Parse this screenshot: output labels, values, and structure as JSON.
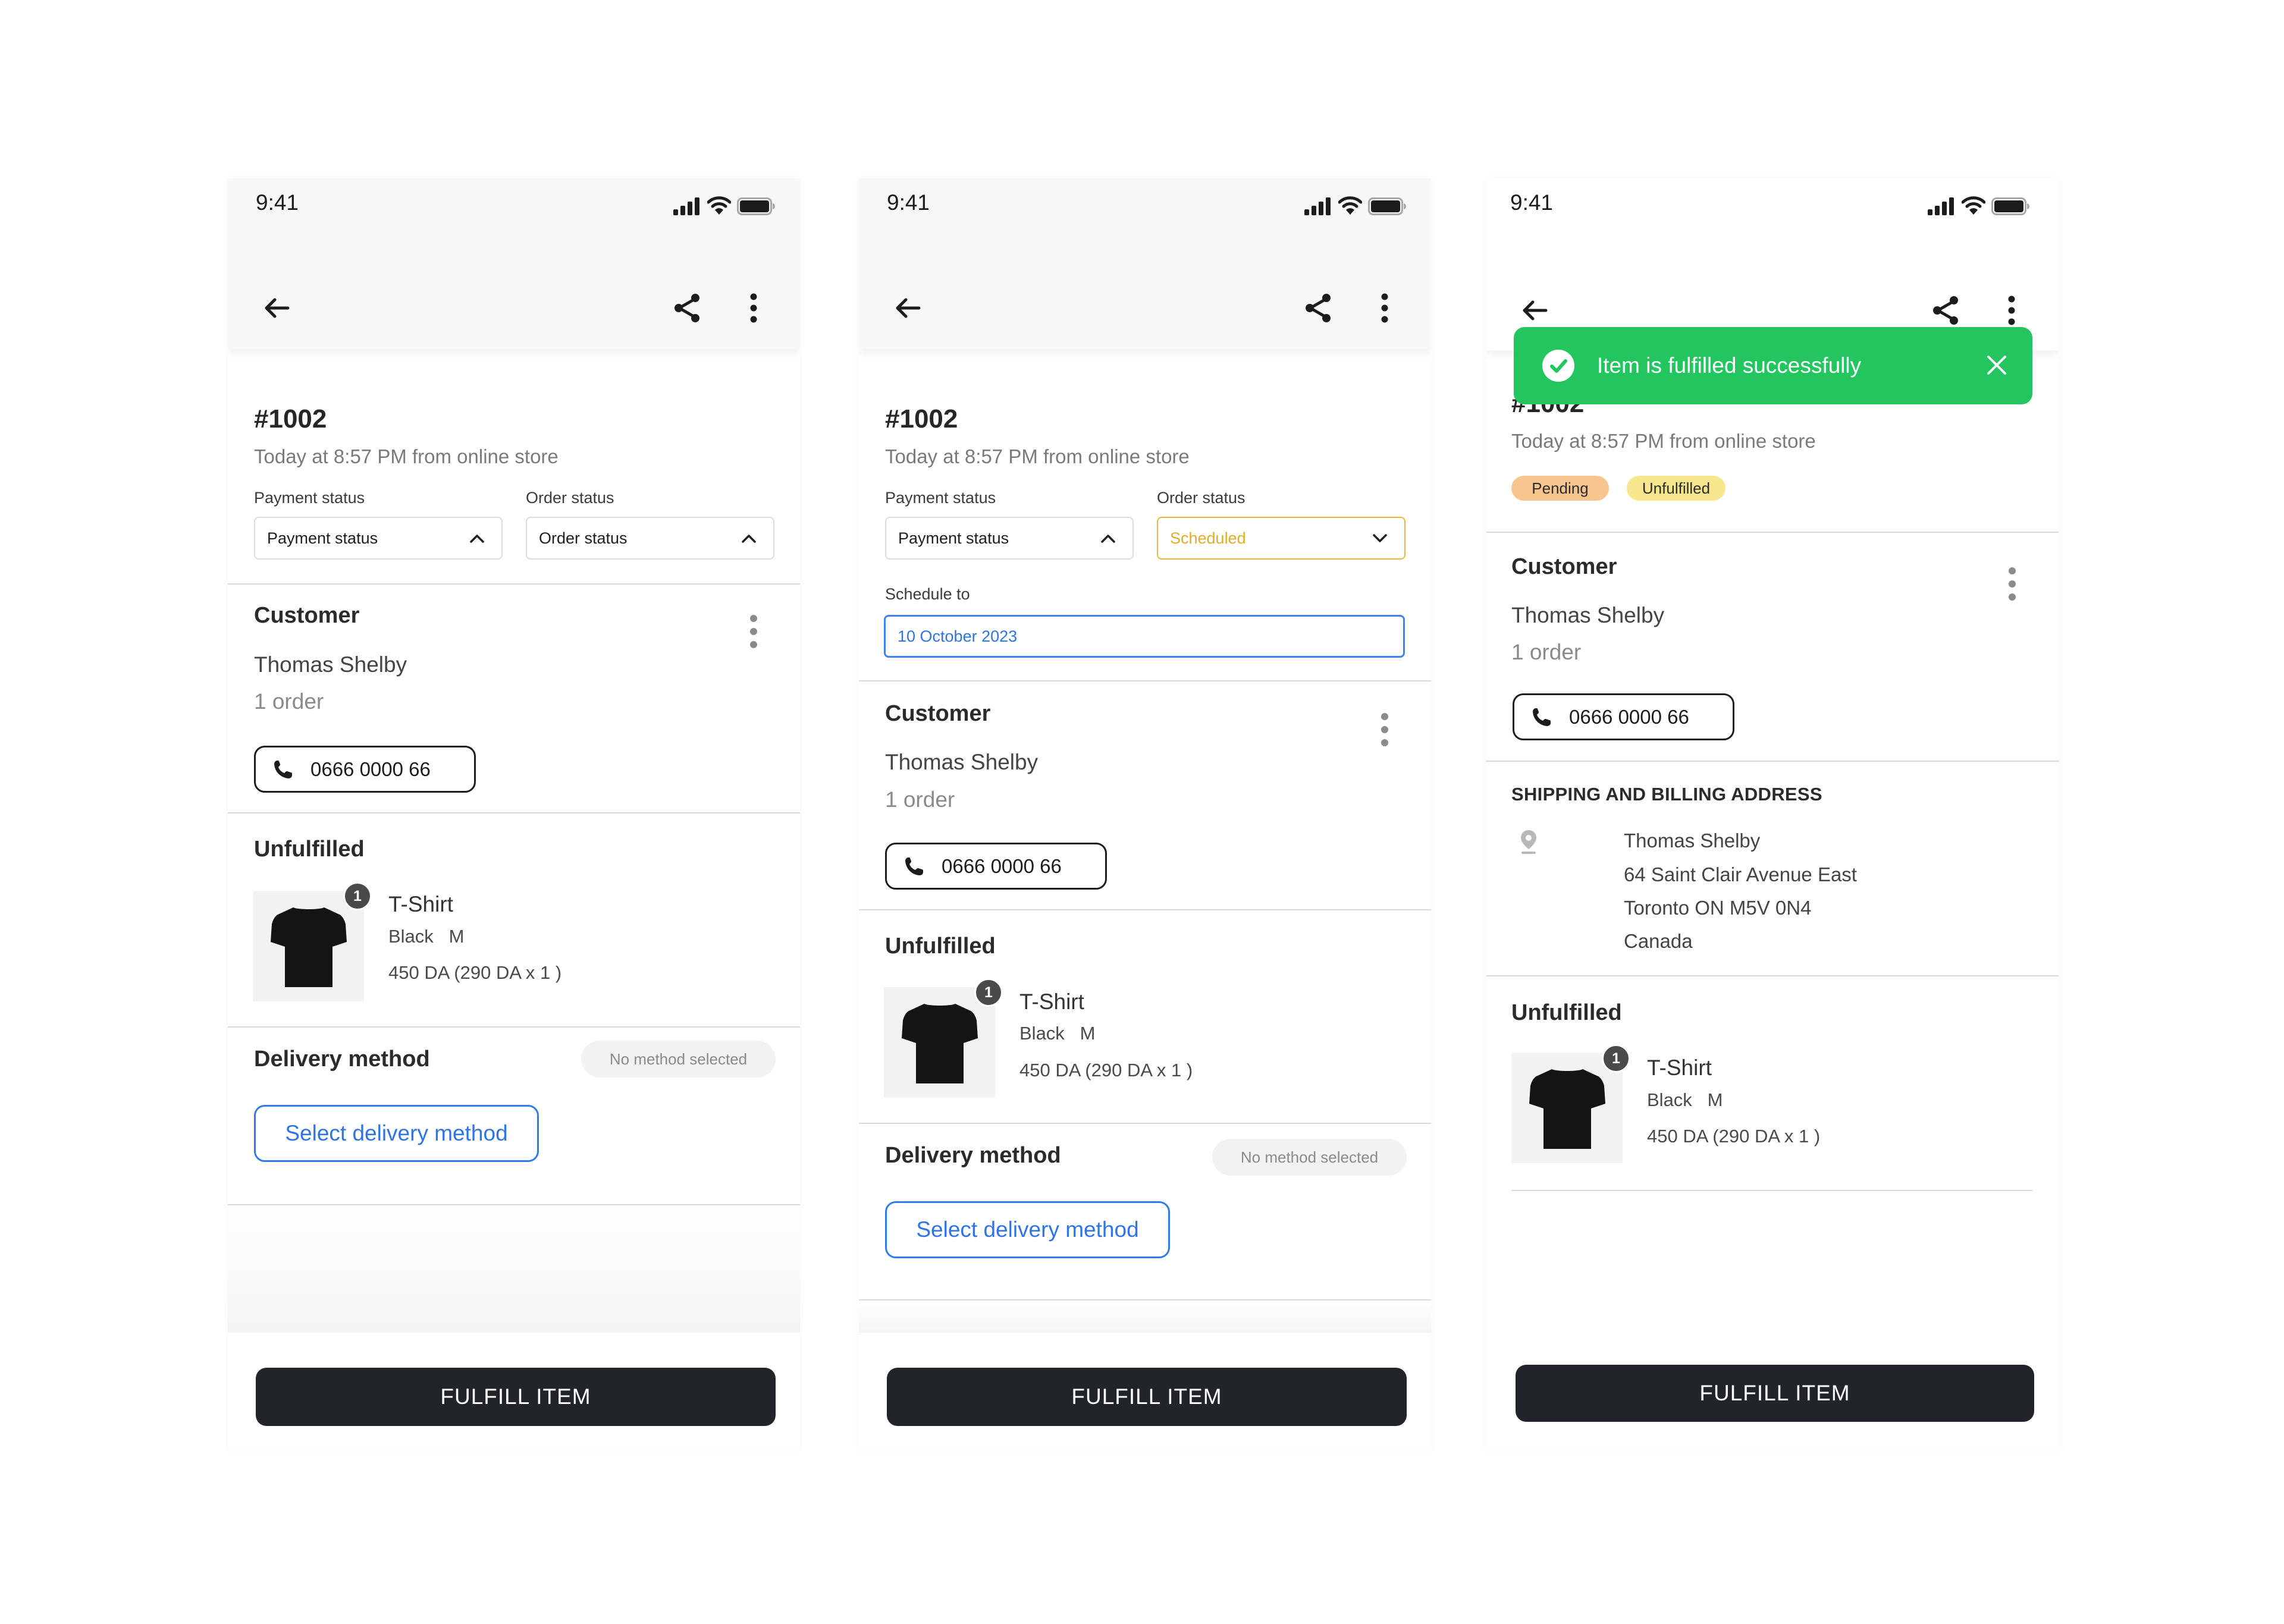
{
  "status_bar": {
    "time": "9:41"
  },
  "order": {
    "number": "#1002",
    "placed": "Today at 8:57 PM from online store"
  },
  "fields": {
    "payment_label": "Payment status",
    "order_label": "Order status",
    "payment_value": "Payment status",
    "order_value": "Order status",
    "order_value_scheduled": "Scheduled",
    "schedule_label": "Schedule to",
    "schedule_value": "10 October 2023"
  },
  "customer": {
    "title": "Customer",
    "name": "Thomas Shelby",
    "orders": "1 order",
    "phone": "0666 0000 66"
  },
  "fulfillment": {
    "title": "Unfulfilled",
    "item": {
      "name": "T-Shirt",
      "variant": "Black   M",
      "price": "450 DA (290 DA x 1 )",
      "quantity": "1"
    }
  },
  "delivery": {
    "title": "Delivery method",
    "status": "No method selected",
    "select_label": "Select delivery method"
  },
  "actions": {
    "fulfill_label": "FULFILL ITEM"
  },
  "toast": {
    "message": "Item is fulfilled successfully"
  },
  "tags": {
    "payment": "Pending",
    "fulfillment": "Unfulfilled"
  },
  "address": {
    "title": "SHIPPING AND BILLING ADDRESS",
    "lines": [
      "Thomas Shelby",
      "64 Saint Clair Avenue East",
      "Toronto ON M5V 0N4",
      "Canada"
    ]
  },
  "colors": {
    "accent_blue": "#2f74e6",
    "scheduled_yellow": "#e0ad2a",
    "success_green": "#22c55e",
    "pending_tag": "#f8c58e",
    "unfulfilled_tag": "#f7e68c",
    "dark_button": "#212428"
  }
}
